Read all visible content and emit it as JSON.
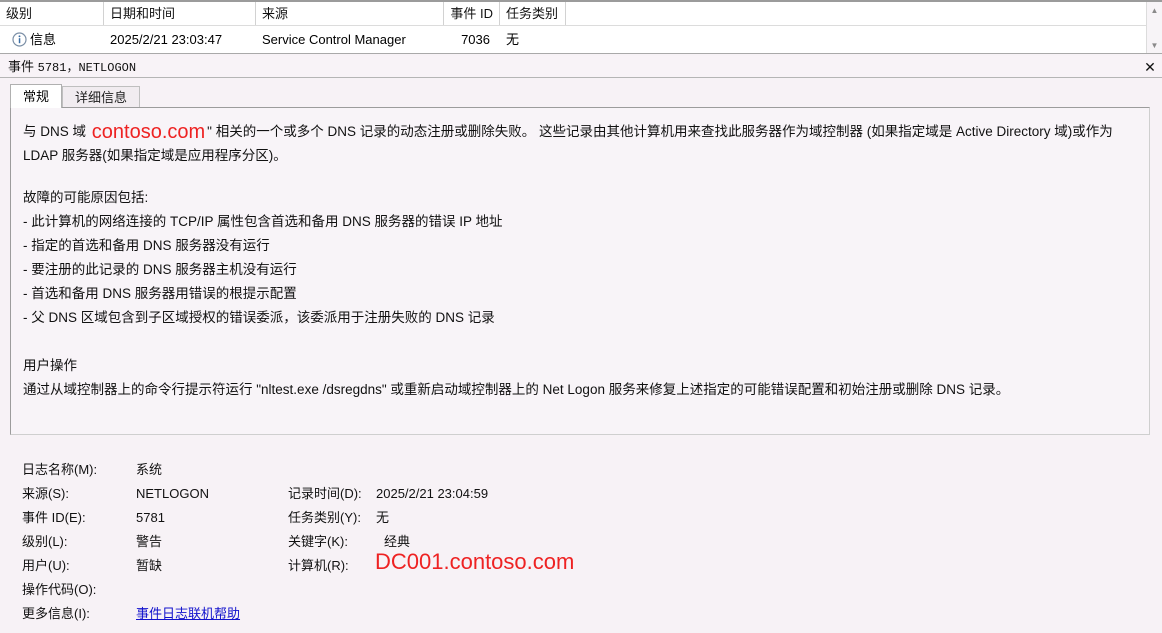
{
  "event_list": {
    "columns": [
      {
        "label": "级别",
        "align": "left"
      },
      {
        "label": "日期和时间",
        "align": "left"
      },
      {
        "label": "来源",
        "align": "left"
      },
      {
        "label": "事件 ID",
        "align": "right"
      },
      {
        "label": "任务类别",
        "align": "left"
      }
    ],
    "row": {
      "level_icon": "information-icon",
      "level": "信息",
      "datetime": "2025/2/21 23:03:47",
      "source": "Service Control Manager",
      "event_id": "7036",
      "task_category": "无"
    },
    "scrollbar": {
      "up": "▲",
      "down": "▼"
    }
  },
  "event_header": {
    "prefix": "事件",
    "id_source": "5781，NETLOGON",
    "close_label": "✕"
  },
  "tabs": [
    {
      "label": "常规",
      "active": true
    },
    {
      "label": "详细信息",
      "active": false
    }
  ],
  "message": {
    "p1_before": "与 DNS 域 ",
    "p1_highlight": "contoso.com",
    "p1_after": "\" 相关的一个或多个 DNS 记录的动态注册或删除失败。 这些记录由其他计算机用来查找此服务器作为域控制器 (如果指定域是 Active Directory 域)或作为 LDAP 服务器(如果指定域是应用程序分区)。",
    "causes_title": "故障的可能原因包括:",
    "causes": [
      "- 此计算机的网络连接的 TCP/IP 属性包含首选和备用 DNS 服务器的错误 IP 地址",
      "- 指定的首选和备用 DNS 服务器没有运行",
      "- 要注册的此记录的 DNS 服务器主机没有运行",
      "- 首选和备用 DNS 服务器用错误的根提示配置",
      "- 父 DNS 区域包含到子区域授权的错误委派，该委派用于注册失败的 DNS 记录"
    ],
    "user_action_title": "用户操作",
    "user_action_body": "通过从域控制器上的命令行提示符运行 \"nltest.exe /dsregdns\" 或重新启动域控制器上的 Net Logon 服务来修复上述指定的可能错误配置和初始注册或删除 DNS 记录。"
  },
  "details": {
    "log_name_label": "日志名称(M):",
    "log_name_value": "系统",
    "source_label": "来源(S):",
    "source_value": "NETLOGON",
    "event_id_label": "事件 ID(E):",
    "event_id_value": "5781",
    "level_label": "级别(L):",
    "level_value": "警告",
    "user_label": "用户(U):",
    "user_value": "暂缺",
    "opcode_label": "操作代码(O):",
    "opcode_value": "",
    "more_info_label": "更多信息(I):",
    "more_info_link": "事件日志联机帮助",
    "logged_label": "记录时间(D):",
    "logged_value": "2025/2/21 23:04:59",
    "task_category_label": "任务类别(Y):",
    "task_category_value": "无",
    "keywords_label": "关键字(K):",
    "keywords_value": "经典",
    "computer_label": "计算机(R):",
    "computer_value": "DC001.contoso.com"
  },
  "colors": {
    "page_bg": "#f7f2f6",
    "list_bg": "#ffffff",
    "highlight_red": "#ee2222",
    "link_blue": "#1111cc",
    "redaction_gray": "#c9c9c9"
  }
}
